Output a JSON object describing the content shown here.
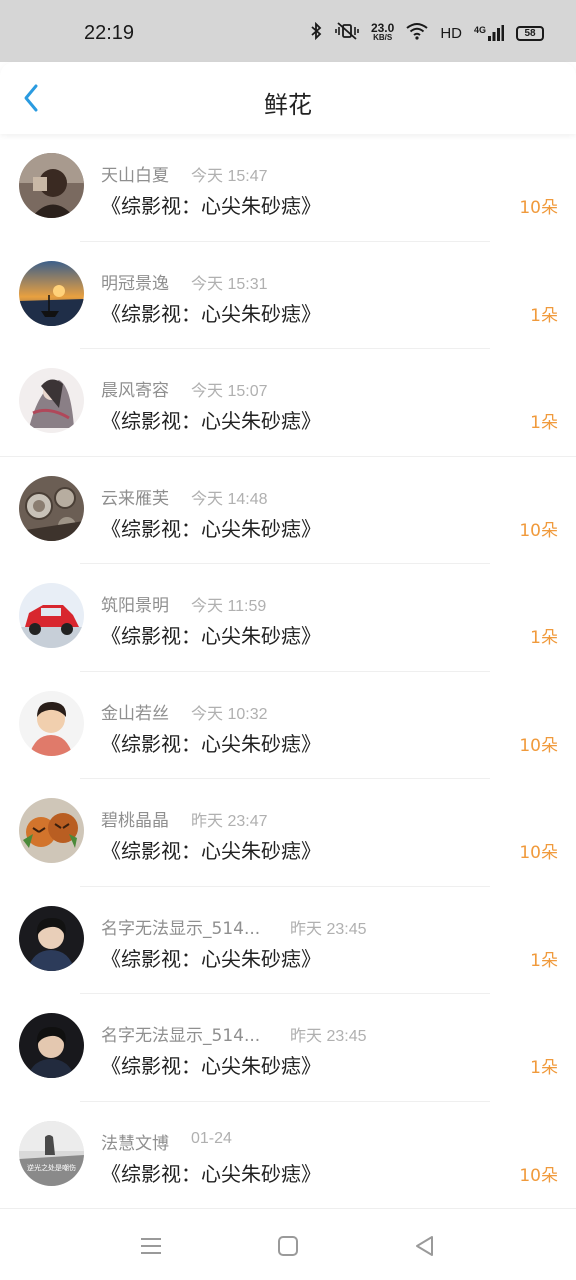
{
  "status_bar": {
    "time": "22:19",
    "net_speed_value": "23.0",
    "net_speed_unit": "KB/S",
    "hd_label": "HD",
    "network_label": "4G",
    "battery": "58"
  },
  "header": {
    "title": "鲜花"
  },
  "colors": {
    "accent_blue": "#2a9be0",
    "quantity_orange": "#f09a3c"
  },
  "records": [
    {
      "name": "天山白夏",
      "time": "今天 15:47",
      "book": "《综影视：心尖朱砂痣》",
      "quantity": "10朵"
    },
    {
      "name": "明冠景逸",
      "time": "今天 15:31",
      "book": "《综影视：心尖朱砂痣》",
      "quantity": "1朵"
    },
    {
      "name": "晨风寄容",
      "time": "今天 15:07",
      "book": "《综影视：心尖朱砂痣》",
      "quantity": "1朵"
    },
    {
      "name": "云来雁芙",
      "time": "今天 14:48",
      "book": "《综影视：心尖朱砂痣》",
      "quantity": "10朵"
    },
    {
      "name": "筑阳景明",
      "time": "今天 11:59",
      "book": "《综影视：心尖朱砂痣》",
      "quantity": "1朵"
    },
    {
      "name": "金山若丝",
      "time": "今天 10:32",
      "book": "《综影视：心尖朱砂痣》",
      "quantity": "10朵"
    },
    {
      "name": "碧桃晶晶",
      "time": "昨天 23:47",
      "book": "《综影视：心尖朱砂痣》",
      "quantity": "10朵"
    },
    {
      "name": "名字无法显示_514...",
      "time": "昨天 23:45",
      "book": "《综影视：心尖朱砂痣》",
      "quantity": "1朵"
    },
    {
      "name": "名字无法显示_514...",
      "time": "昨天 23:45",
      "book": "《综影视：心尖朱砂痣》",
      "quantity": "1朵"
    },
    {
      "name": "法慧文博",
      "time": "01-24",
      "book": "《综影视：心尖朱砂痣》",
      "quantity": "10朵"
    }
  ],
  "avatar_9_caption": "逆光之处是嘲伤",
  "nav_icons": [
    "menu-icon",
    "home-icon",
    "back-triangle-icon"
  ],
  "status_icons": [
    "bluetooth-icon",
    "vibrate-mute-icon",
    "wifi-icon",
    "signal-icon",
    "battery-icon"
  ]
}
